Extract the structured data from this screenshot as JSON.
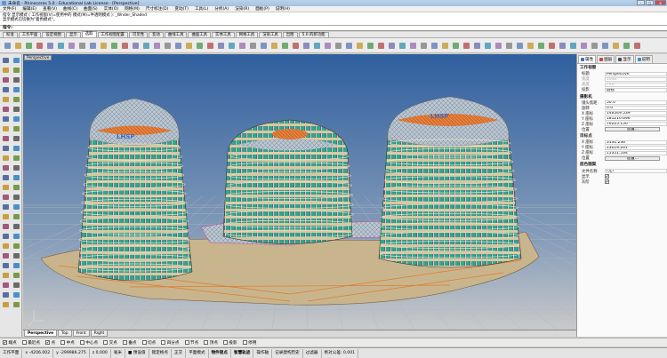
{
  "window": {
    "title": "未命名 - Rhinoceros 5.0 - Educational Lab License - [Perspective]"
  },
  "menu": [
    "文件(F)",
    "编辑(E)",
    "查看(V)",
    "曲线(C)",
    "曲面(S)",
    "实体(O)",
    "网格(M)",
    "尺寸标注(D)",
    "变动(T)",
    "工具(L)",
    "分析(A)",
    "渲染(R)",
    "面板(P)",
    "说明(H)"
  ],
  "command": {
    "history": [
      "指令:显示模式 ( 工作视窗(V)=使用中的  模式(M)=半透明模式 ): _Wnder_Shaded",
      "显示模式已切换为\"着色模式\"。"
    ],
    "prompt": "指令:"
  },
  "toolbar_tabs": [
    "标准",
    "工作平面",
    "设定视图",
    "显示",
    "选取",
    "工作视窗配置",
    "可见性",
    "变动",
    "曲线工具",
    "曲面工具",
    "实体工具",
    "网格工具",
    "渲染工具",
    "出图",
    "5.0 的新功能"
  ],
  "toolbar_active_tab": "选取",
  "viewport": {
    "label": "Perspective",
    "tabs": [
      "Perspective",
      "Top",
      "Front",
      "Right"
    ],
    "active": "Perspective",
    "logo_text": "LHSP"
  },
  "panel": {
    "tabs": [
      {
        "label": "属性",
        "color": "#3a6fc0"
      },
      {
        "label": "图层",
        "color": "#c04a3a"
      },
      {
        "label": "显示",
        "color": "#4a4a4a"
      },
      {
        "label": "说明",
        "color": "#3a8fc0"
      }
    ],
    "active_tab": "属性",
    "sections": [
      {
        "title": "工作视窗",
        "rows": [
          {
            "k": "标题",
            "v": "Perspective"
          },
          {
            "k": "宽度",
            "v": "1046",
            "dim": true
          },
          {
            "k": "高度",
            "v": "740",
            "dim": true
          },
          {
            "k": "投影",
            "v": "透视"
          }
        ]
      },
      {
        "title": "摄影机",
        "rows": [
          {
            "k": "镜头焦距",
            "v": "50.0"
          },
          {
            "k": "旋转",
            "v": "0.0"
          },
          {
            "k": "X 座标",
            "v": "146549.539"
          },
          {
            "k": "Y 座标",
            "v": "181210.696"
          },
          {
            "k": "Z 座标",
            "v": "76225.150"
          },
          {
            "k": "位置",
            "v": "放置...",
            "btn": true
          }
        ]
      },
      {
        "title": "目标点",
        "rows": [
          {
            "k": "X 座标",
            "v": "3131.236"
          },
          {
            "k": "Y 座标",
            "v": "13019.261"
          },
          {
            "k": "Z 座标",
            "v": "15351.534"
          },
          {
            "k": "位置",
            "v": "放置...",
            "btn": true
          }
        ]
      },
      {
        "title": "底色图案",
        "rows": [
          {
            "k": "文件名称",
            "v": "(无)"
          },
          {
            "k": "显示",
            "v": "✔",
            "chk": true
          },
          {
            "k": "灰阶",
            "v": "✔",
            "chk": true
          }
        ]
      }
    ]
  },
  "osnap": [
    {
      "label": "端点",
      "on": true
    },
    {
      "label": "最近点",
      "on": false
    },
    {
      "label": "点",
      "on": true
    },
    {
      "label": "中点",
      "on": false
    },
    {
      "label": "中心点",
      "on": false
    },
    {
      "label": "交点",
      "on": false
    },
    {
      "label": "垂点",
      "on": false
    },
    {
      "label": "切点",
      "on": false
    },
    {
      "label": "四分点",
      "on": false
    },
    {
      "label": "节点",
      "on": false
    },
    {
      "label": "顶点",
      "on": false
    },
    {
      "label": "投影",
      "on": false
    },
    {
      "label": "停用",
      "on": false
    }
  ],
  "status": {
    "plane": "工作平面",
    "x": "x -4206.002",
    "y": "y -299986.275",
    "z": "z 0.000",
    "units": "毫米",
    "layer": "■ 预设值",
    "items": [
      "锁定格点",
      "正交",
      "平面模式",
      "物件锁点",
      "智慧轨迹",
      "操作轴",
      "记录建构历史",
      "过滤器",
      "绝对公差: 0.001"
    ]
  },
  "colors": {
    "viewport_top": "#2f5f9e",
    "viewport_bottom": "#c9c9c9",
    "grid": "#aeb6c2",
    "building_fill": "#c8b996",
    "glass_green": "#28a88a",
    "trim": "#e07a2a",
    "highlight": "#9bd0e6"
  }
}
